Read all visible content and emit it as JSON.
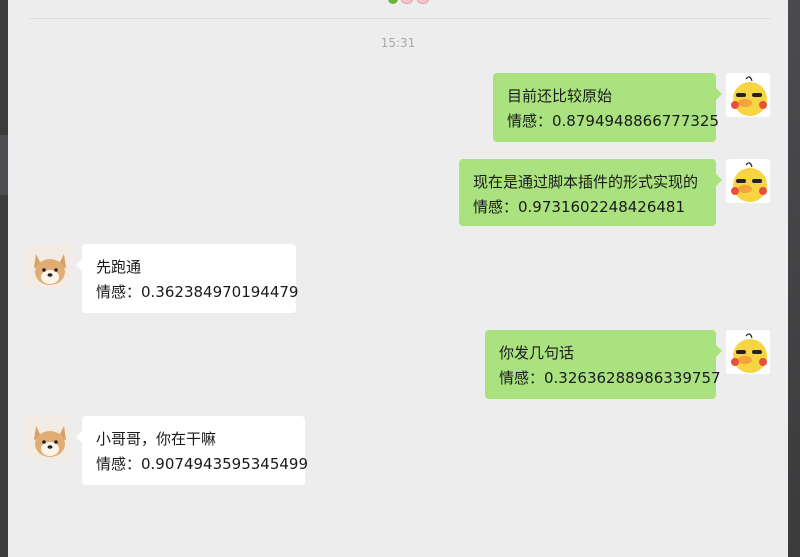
{
  "chat": {
    "timestamp": "15:31",
    "messages": [
      {
        "sender": "me",
        "text": "目前还比较原始",
        "sentiment": "情感：0.8794948866777325"
      },
      {
        "sender": "me",
        "text": "现在是通过脚本插件的形式实现的",
        "sentiment": "情感：0.9731602248426481"
      },
      {
        "sender": "them",
        "text": "先跑通",
        "sentiment": "情感：0.362384970194479"
      },
      {
        "sender": "me",
        "text": "你发几句话",
        "sentiment": "情感：0.32636288986339757"
      },
      {
        "sender": "them",
        "text": "小哥哥，你在干嘛",
        "sentiment": "情感：0.9074943595345499"
      }
    ]
  },
  "icons": {
    "my_avatar": "yellow-duck-avatar",
    "their_avatar": "shiba-dog-avatar",
    "top_emoji": "leaf-bun-emoji"
  },
  "colors": {
    "background": "#ededed",
    "my_bubble": "#a9e27e",
    "their_bubble": "#ffffff",
    "timestamp": "#a9a9a9"
  }
}
